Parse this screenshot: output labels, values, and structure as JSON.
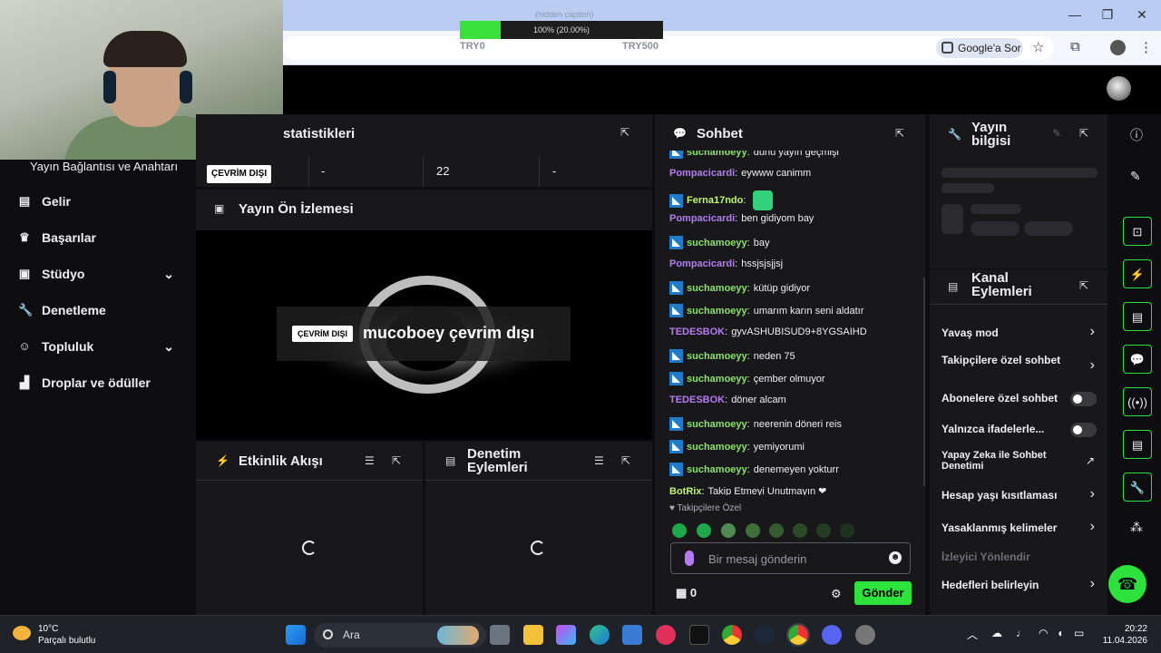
{
  "progress": {
    "label": "(hidden caption)",
    "text": "100% (20.00%)",
    "fraction": 0.2,
    "min_label": "TRY0",
    "max_label": "TRY500"
  },
  "browser": {
    "ask_google": "Google'a Sor"
  },
  "nav": {
    "stream_keys": "Yayın Bağlantısı ve Anahtarı",
    "items": [
      {
        "label": "Gelir",
        "icon": "bar-chart-icon"
      },
      {
        "label": "Başarılar",
        "icon": "trophy-icon"
      },
      {
        "label": "Stüdyo",
        "icon": "studio-icon"
      },
      {
        "label": "Denetleme",
        "icon": "wrench-icon"
      },
      {
        "label": "Topluluk",
        "icon": "community-icon"
      },
      {
        "label": "Droplar ve ödüller",
        "icon": "gift-icon"
      }
    ]
  },
  "stats": {
    "title": "statistikleri",
    "status": "ÇEVRİM DIŞI",
    "cells": [
      "-",
      "22",
      "-"
    ]
  },
  "preview": {
    "title": "Yayın Ön İzlemesi",
    "badge": "ÇEVRİM DIŞI",
    "offline_text": "mucoboey çevrim dışı"
  },
  "activity": {
    "title": "Etkinlik Akışı"
  },
  "mod_actions": {
    "title": "Denetim Eylemleri"
  },
  "chat": {
    "title": "Sohbet",
    "messages": [
      {
        "user": "suchamoeyy",
        "text": "dünü yayın geçmişi",
        "badge": true,
        "color": "green"
      },
      {
        "user": "Pompacicardi",
        "text": "eywww canimm",
        "badge": false,
        "color": "purple"
      },
      {
        "user": "Ferna17ndo",
        "text": "",
        "badge": true,
        "color": "lime"
      },
      {
        "user": "Pompacicardi",
        "text": "ben gidiyom bay",
        "badge": false,
        "color": "purple"
      },
      {
        "user": "suchamoeyy",
        "text": "bay",
        "badge": true,
        "color": "green"
      },
      {
        "user": "Pompacicardi",
        "text": "hssjsjsjjsj",
        "badge": false,
        "color": "purple"
      },
      {
        "user": "suchamoeyy",
        "text": "kütüp gidiyor",
        "badge": true,
        "color": "green"
      },
      {
        "user": "suchamoeyy",
        "text": "umarım karın seni aldatır",
        "badge": true,
        "color": "green"
      },
      {
        "user": "TEDESBOK",
        "text": "gyvASHUBISUD9+8YGSAIHD",
        "badge": false,
        "color": "purple"
      },
      {
        "user": "suchamoeyy",
        "text": "neden 75",
        "badge": true,
        "color": "green"
      },
      {
        "user": "suchamoeyy",
        "text": "çember olmuyor",
        "badge": true,
        "color": "green"
      },
      {
        "user": "TEDESBOK",
        "text": "döner alcam",
        "badge": false,
        "color": "purple"
      },
      {
        "user": "suchamoeyy",
        "text": "neerenin döneri reis",
        "badge": true,
        "color": "green"
      },
      {
        "user": "suchamoeyy",
        "text": "yemiyorumi",
        "badge": true,
        "color": "green"
      },
      {
        "user": "suchamoeyy",
        "text": "denemeyen yokturr",
        "badge": true,
        "color": "green"
      },
      {
        "user": "BotRix",
        "text": "Takip Etmeyi Unutmayın ❤",
        "badge": false,
        "color": "lime"
      }
    ],
    "followers_only": "Takipçilere Özel",
    "placeholder": "Bir mesaj gönderin",
    "send": "Gönder",
    "points": "0"
  },
  "stream_info": {
    "title": "Yayın bilgisi"
  },
  "channel_actions": {
    "title": "Kanal Eylemleri",
    "items": [
      {
        "label": "Yavaş mod",
        "control": "chevron"
      },
      {
        "label": "Takipçilere özel sohbet",
        "control": "chevron"
      },
      {
        "label": "Abonelere özel sohbet",
        "control": "toggle"
      },
      {
        "label": "Yalnızca ifadelerle...",
        "control": "toggle"
      },
      {
        "label": "Yapay Zeka ile Sohbet Denetimi",
        "control": "external"
      },
      {
        "label": "Hesap yaşı kısıtlaması",
        "control": "chevron"
      },
      {
        "label": "Yasaklanmış kelimeler",
        "control": "chevron"
      },
      {
        "label": "İzleyici Yönlendir",
        "control": "none"
      },
      {
        "label": "Hedefleri belirleyin",
        "control": "chevron"
      }
    ]
  },
  "taskbar": {
    "temp": "10°C",
    "weather": "Parçalı bulutlu",
    "search": "Ara",
    "time": "20:22",
    "date": "11.04.2026"
  },
  "colors": {
    "accent": "#2ee23e",
    "panel": "#18181b",
    "bg": "#0e0e10"
  }
}
